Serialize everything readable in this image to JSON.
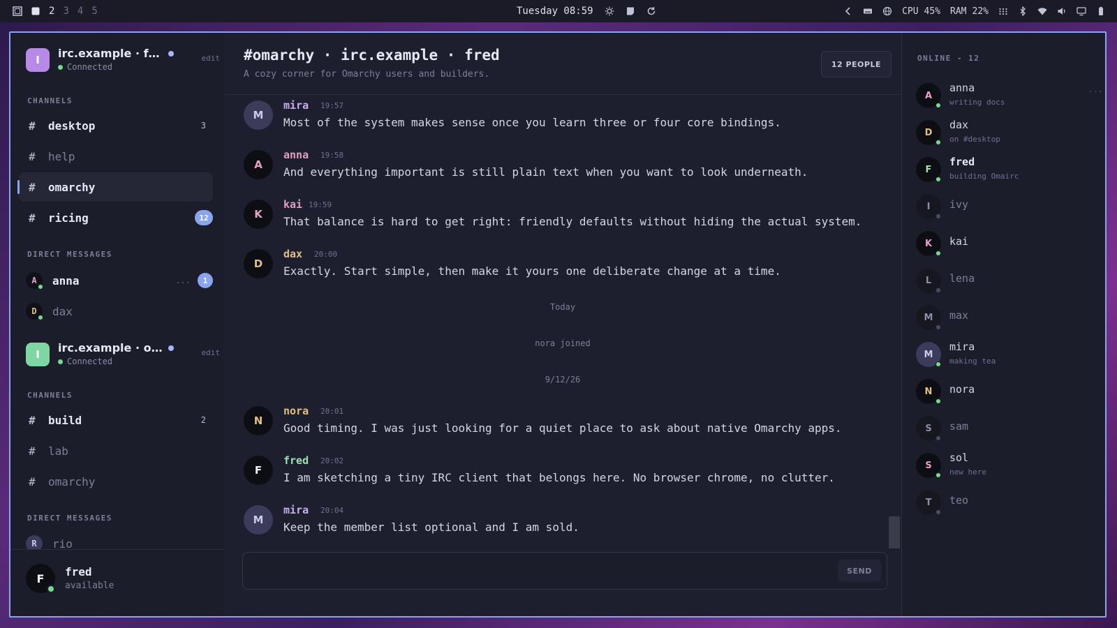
{
  "topbar": {
    "workspaces": [
      "2",
      "3",
      "4",
      "5"
    ],
    "clock": "Tuesday 08:59",
    "cpu_label": "CPU",
    "cpu_value": "45%",
    "ram_label": "RAM",
    "ram_value": "22%"
  },
  "servers": [
    {
      "avatar": "I",
      "name": "irc.example · f…",
      "status": "Connected",
      "edit": "edit",
      "avatar_color": "#b88ae8",
      "channels_label": "CHANNELS",
      "channels": [
        {
          "name": "desktop",
          "count": "3"
        },
        {
          "name": "help"
        },
        {
          "name": "omarchy"
        },
        {
          "name": "ricing",
          "badge": "12"
        }
      ],
      "dm_label": "DIRECT MESSAGES",
      "dms": [
        {
          "avatar": "A",
          "name": "anna",
          "dots": "...",
          "badge": "1"
        },
        {
          "avatar": "D",
          "name": "dax"
        }
      ]
    },
    {
      "avatar": "I",
      "name": "irc.example · o…",
      "status": "Connected",
      "edit": "edit",
      "avatar_color": "#7ed6a0",
      "channels_label": "CHANNELS",
      "channels": [
        {
          "name": "build",
          "count": "2"
        },
        {
          "name": "lab"
        },
        {
          "name": "omarchy"
        }
      ],
      "dm_label": "DIRECT MESSAGES",
      "dms": [
        {
          "avatar": "R",
          "name": "rio"
        }
      ]
    }
  ],
  "me": {
    "avatar": "F",
    "name": "fred",
    "status": "available"
  },
  "main": {
    "title": "#omarchy · irc.example · fred",
    "subtitle": "A cozy corner for Omarchy users and builders.",
    "people_button": "12 PEOPLE",
    "send_label": "SEND",
    "input_placeholder": ""
  },
  "messages": [
    {
      "avatar": "M",
      "user": "mira",
      "time": "19:57",
      "text": "Most of the system makes sense once you learn three or four core bindings."
    },
    {
      "avatar": "A",
      "user": "anna",
      "time": "19:58",
      "text": "And everything important is still plain text when you want to look underneath."
    },
    {
      "avatar": "K",
      "user": "kai",
      "time": "19:59",
      "text": "That balance is hard to get right: friendly defaults without hiding the actual system."
    },
    {
      "avatar": "D",
      "user": "dax",
      "time": "20:00",
      "text": "Exactly. Start simple, then make it yours one deliberate change at a time."
    },
    {
      "avatar": "N",
      "user": "nora",
      "time": "20:01",
      "text": "Good timing. I was just looking for a quiet place to ask about native Omarchy apps."
    },
    {
      "avatar": "F",
      "user": "fred",
      "time": "20:02",
      "text": "I am sketching a tiny IRC client that belongs here. No browser chrome, no clutter."
    },
    {
      "avatar": "M",
      "user": "mira",
      "time": "20:04",
      "text": "Keep the member list optional and I am sold."
    }
  ],
  "system": {
    "day": "Today",
    "joined": "nora joined",
    "date": "9/12/26"
  },
  "members": {
    "label": "ONLINE - 12",
    "more": "...",
    "list": [
      {
        "avatar": "A",
        "name": "anna",
        "activity": "writing docs"
      },
      {
        "avatar": "D",
        "name": "dax",
        "activity": "on #desktop"
      },
      {
        "avatar": "F",
        "name": "fred",
        "activity": "building Omairc"
      },
      {
        "avatar": "I",
        "name": "ivy"
      },
      {
        "avatar": "K",
        "name": "kai"
      },
      {
        "avatar": "L",
        "name": "lena"
      },
      {
        "avatar": "M",
        "name": "max"
      },
      {
        "avatar": "M",
        "name": "mira",
        "activity": "making tea"
      },
      {
        "avatar": "N",
        "name": "nora"
      },
      {
        "avatar": "S",
        "name": "sam"
      },
      {
        "avatar": "S",
        "name": "sol",
        "activity": "new here"
      },
      {
        "avatar": "T",
        "name": "teo"
      }
    ]
  },
  "colors": {
    "accent": "#8aa4f0",
    "online": "#7bd88f",
    "background": "#1e1f2e"
  }
}
